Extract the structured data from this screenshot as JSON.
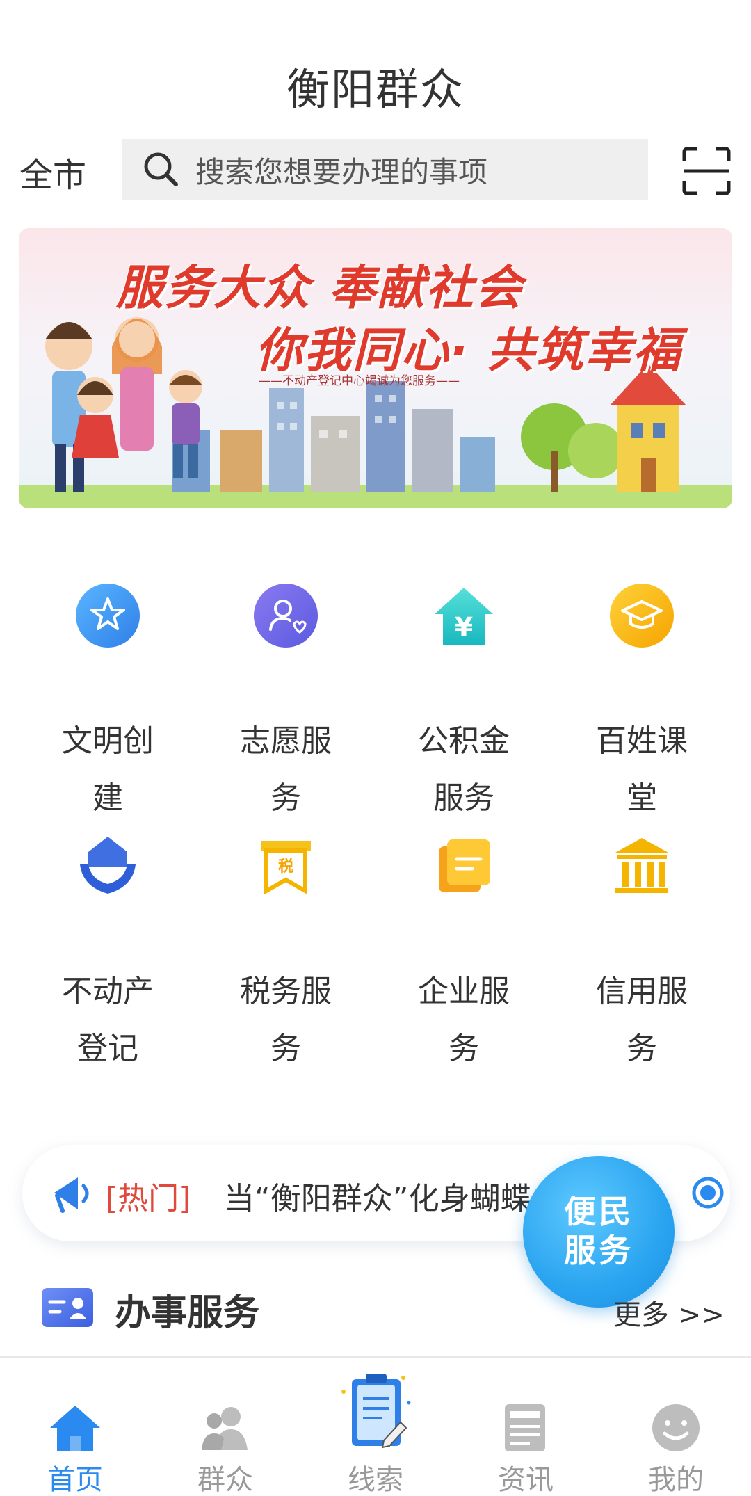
{
  "header": {
    "title": "衡阳群众"
  },
  "search": {
    "city": "全市",
    "placeholder": "搜索您想要办理的事项"
  },
  "banner": {
    "line1": "服务大众 奉献社会",
    "line2": "你我同心· 共筑幸福",
    "caption": "——不动产登记中心竭诚为您服务——"
  },
  "services": [
    {
      "label": "文明创建",
      "icon": "flower-icon"
    },
    {
      "label": "志愿服务",
      "icon": "volunteer-icon"
    },
    {
      "label": "公积金服务",
      "icon": "housing-fund-icon"
    },
    {
      "label": "百姓课堂",
      "icon": "graduation-cap-icon"
    },
    {
      "label": "不动产登记",
      "icon": "property-hands-icon"
    },
    {
      "label": "税务服务",
      "icon": "tax-ribbon-icon"
    },
    {
      "label": "企业服务",
      "icon": "document-icon"
    },
    {
      "label": "信用服务",
      "icon": "bank-icon"
    }
  ],
  "hot": {
    "tag": "[热门]",
    "text": "当“衡阳群众”化身蝴蝶....."
  },
  "fab": {
    "line1": "便民",
    "line2": "服务"
  },
  "section": {
    "title": "办事服务",
    "more": "更多 >>"
  },
  "tabs": [
    {
      "label": "首页",
      "icon": "home-icon",
      "active": true
    },
    {
      "label": "群众",
      "icon": "people-icon",
      "active": false
    },
    {
      "label": "线索",
      "icon": "clipboard-icon",
      "active": false
    },
    {
      "label": "资讯",
      "icon": "news-icon",
      "active": false
    },
    {
      "label": "我的",
      "icon": "smile-icon",
      "active": false
    }
  ],
  "colors": {
    "accent": "#2a8af0",
    "hot_red": "#e0493d",
    "banner_red": "#e03a2c"
  }
}
